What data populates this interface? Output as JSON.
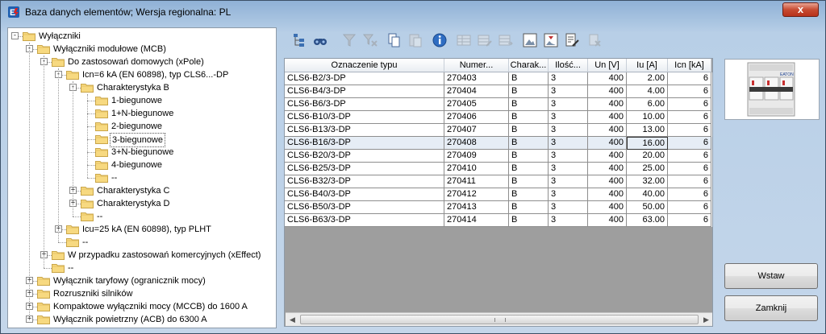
{
  "window": {
    "title": "Baza danych elementów; Wersja regionalna: PL",
    "close_label": "x"
  },
  "tree": {
    "nodes": [
      {
        "label": "Wyłączniki",
        "depth": 0,
        "expander": "-",
        "selected": false
      },
      {
        "label": "Wyłączniki modułowe (MCB)",
        "depth": 1,
        "expander": "-",
        "selected": false
      },
      {
        "label": "Do zastosowań domowych (xPole)",
        "depth": 2,
        "expander": "-",
        "selected": false
      },
      {
        "label": "Icn=6 kA (EN 60898), typ CLS6...-DP",
        "depth": 3,
        "expander": "-",
        "selected": false
      },
      {
        "label": "Charakterystyka B",
        "depth": 4,
        "expander": "-",
        "selected": false
      },
      {
        "label": "1-biegunowe",
        "depth": 5,
        "expander": "",
        "selected": false
      },
      {
        "label": "1+N-biegunowe",
        "depth": 5,
        "expander": "",
        "selected": false
      },
      {
        "label": "2-biegunowe",
        "depth": 5,
        "expander": "",
        "selected": false
      },
      {
        "label": "3-biegunowe",
        "depth": 5,
        "expander": "",
        "selected": true
      },
      {
        "label": "3+N-biegunowe",
        "depth": 5,
        "expander": "",
        "selected": false
      },
      {
        "label": "4-biegunowe",
        "depth": 5,
        "expander": "",
        "selected": false
      },
      {
        "label": "--",
        "depth": 5,
        "expander": "",
        "selected": false
      },
      {
        "label": "Charakterystyka C",
        "depth": 4,
        "expander": "+",
        "selected": false
      },
      {
        "label": "Charakterystyka D",
        "depth": 4,
        "expander": "+",
        "selected": false
      },
      {
        "label": "--",
        "depth": 4,
        "expander": "",
        "selected": false
      },
      {
        "label": "Icu=25 kA (EN 60898), typ PLHT",
        "depth": 3,
        "expander": "+",
        "selected": false
      },
      {
        "label": "--",
        "depth": 3,
        "expander": "",
        "selected": false
      },
      {
        "label": "W przypadku zastosowań komercyjnych (xEffect)",
        "depth": 2,
        "expander": "+",
        "selected": false
      },
      {
        "label": "--",
        "depth": 2,
        "expander": "",
        "selected": false
      },
      {
        "label": "Wyłącznik taryfowy (ogranicznik mocy)",
        "depth": 1,
        "expander": "+",
        "selected": false
      },
      {
        "label": "Rozruszniki silników",
        "depth": 1,
        "expander": "+",
        "selected": false
      },
      {
        "label": "Kompaktowe wyłączniki mocy (MCCB) do 1600 A",
        "depth": 1,
        "expander": "+",
        "selected": false
      },
      {
        "label": "Wyłącznik powietrzny (ACB) do 6300 A",
        "depth": 1,
        "expander": "+",
        "selected": false
      }
    ]
  },
  "toolbar": {
    "buttons": [
      {
        "name": "tree-view-icon",
        "enabled": true
      },
      {
        "name": "binoculars-icon",
        "enabled": true
      },
      {
        "name": "filter-icon",
        "enabled": false
      },
      {
        "name": "filter-clear-icon",
        "enabled": false
      },
      {
        "name": "copy-icon",
        "enabled": true
      },
      {
        "name": "paste-icon",
        "enabled": false
      },
      {
        "name": "info-icon",
        "enabled": true
      },
      {
        "name": "table-icon",
        "enabled": false
      },
      {
        "name": "table-edit-icon",
        "enabled": false
      },
      {
        "name": "table-arrow-icon",
        "enabled": false
      },
      {
        "name": "image-export-icon",
        "enabled": true
      },
      {
        "name": "image-import-icon",
        "enabled": true
      },
      {
        "name": "document-edit-icon",
        "enabled": true
      },
      {
        "name": "delete-icon",
        "enabled": false
      }
    ]
  },
  "grid": {
    "columns": [
      "Oznaczenie typu",
      "Numer...",
      "Charak...",
      "Ilość...",
      "Un [V]",
      "Iu [A]",
      "Icn [kA]"
    ],
    "rows": [
      [
        "CLS6-B2/3-DP",
        "270403",
        "B",
        "3",
        "400",
        "2.00",
        "6"
      ],
      [
        "CLS6-B4/3-DP",
        "270404",
        "B",
        "3",
        "400",
        "4.00",
        "6"
      ],
      [
        "CLS6-B6/3-DP",
        "270405",
        "B",
        "3",
        "400",
        "6.00",
        "6"
      ],
      [
        "CLS6-B10/3-DP",
        "270406",
        "B",
        "3",
        "400",
        "10.00",
        "6"
      ],
      [
        "CLS6-B13/3-DP",
        "270407",
        "B",
        "3",
        "400",
        "13.00",
        "6"
      ],
      [
        "CLS6-B16/3-DP",
        "270408",
        "B",
        "3",
        "400",
        "16.00",
        "6"
      ],
      [
        "CLS6-B20/3-DP",
        "270409",
        "B",
        "3",
        "400",
        "20.00",
        "6"
      ],
      [
        "CLS6-B25/3-DP",
        "270410",
        "B",
        "3",
        "400",
        "25.00",
        "6"
      ],
      [
        "CLS6-B32/3-DP",
        "270411",
        "B",
        "3",
        "400",
        "32.00",
        "6"
      ],
      [
        "CLS6-B40/3-DP",
        "270412",
        "B",
        "3",
        "400",
        "40.00",
        "6"
      ],
      [
        "CLS6-B50/3-DP",
        "270413",
        "B",
        "3",
        "400",
        "50.00",
        "6"
      ],
      [
        "CLS6-B63/3-DP",
        "270414",
        "B",
        "3",
        "400",
        "63.00",
        "6"
      ]
    ],
    "selected_row": 5,
    "focused_column": 5
  },
  "product_image": {
    "brand_text": "EATON"
  },
  "buttons": {
    "insert_label": "Wstaw",
    "close_label": "Zamknij"
  },
  "colors": {
    "folder": "#f7d980",
    "selection": "#e6edf5",
    "title_gradient_top": "#8fb1d6"
  }
}
